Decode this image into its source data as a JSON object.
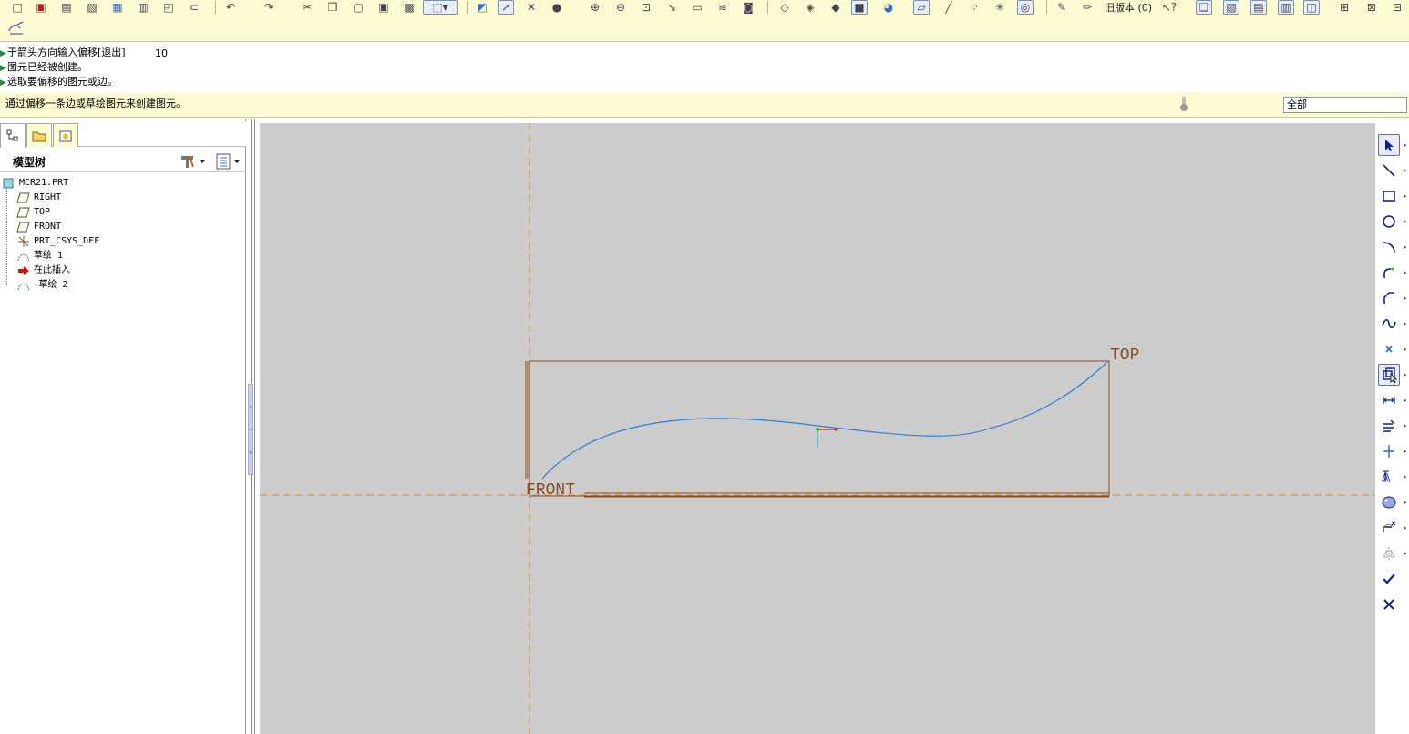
{
  "toolbar": {
    "version_label": "旧版本 (0)",
    "icons": [
      "new-icon",
      "open-icon",
      "save-icon",
      "print-icon",
      "undo-icon",
      "redo-icon",
      "cut-icon",
      "copy-icon",
      "paste-icon",
      "select-box-icon",
      "regenerate-icon",
      "repaint-icon",
      "zoom-in-icon",
      "zoom-out-icon",
      "refit-icon",
      "view-icon",
      "layers-icon",
      "saved-view-icon",
      "datum-plane-icon",
      "datum-axis-icon",
      "datum-point-icon",
      "csys-icon",
      "help-icon",
      "window-icon"
    ],
    "sketch_mode_icon": "sketch-mode-icon"
  },
  "messages": {
    "lines": [
      "于箭头方向输入偏移[退出]",
      "图元已经被创建。",
      "选取要偏移的图元或边。"
    ],
    "offset_value": "10",
    "status": "通过偏移一条边或草绘图元来创建图元。"
  },
  "filter": {
    "selected": "全部"
  },
  "model_tree": {
    "title": "模型树",
    "items": [
      {
        "label": "MCR21.PRT",
        "icon": "part-icon"
      },
      {
        "label": "RIGHT",
        "icon": "datum-plane-icon"
      },
      {
        "label": "TOP",
        "icon": "datum-plane-icon"
      },
      {
        "label": "FRONT",
        "icon": "datum-plane-icon"
      },
      {
        "label": "PRT_CSYS_DEF",
        "icon": "csys-icon"
      },
      {
        "label": "草绘 1",
        "icon": "sketch-icon"
      },
      {
        "label": "在此插入",
        "icon": "insert-here-arrow-icon"
      },
      {
        "label": "草绘 2",
        "icon": "sketch-icon"
      }
    ]
  },
  "canvas": {
    "plane_labels": {
      "top": "TOP",
      "front": "FRONT"
    },
    "colors": {
      "background": "#cccccc",
      "datum": "#8b4a1c",
      "centerline": "#e08a2a",
      "spline": "#2f7fd4"
    }
  },
  "sketch_tools": [
    "select-arrow-icon",
    "line-icon",
    "rectangle-icon",
    "circle-icon",
    "arc-icon",
    "fillet-icon",
    "chamfer-icon",
    "spline-icon",
    "point-icon",
    "offset-edge-icon",
    "dimension-icon",
    "modify-icon",
    "constraint-icon",
    "text-icon",
    "palette-icon",
    "trim-icon",
    "mirror-icon",
    "accept-check-icon",
    "cancel-x-icon"
  ],
  "active_tool": "offset-edge-icon"
}
